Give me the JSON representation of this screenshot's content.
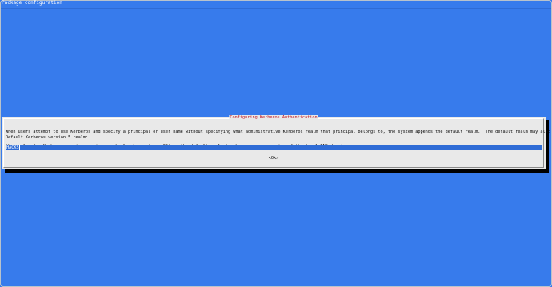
{
  "backtitle": "Package configuration",
  "dialog": {
    "title": "Configuring Kerberos Authentication",
    "message_lines": [
      "When users attempt to use Kerberos and specify a principal or user name without specifying what administrative Kerberos realm that principal belongs to, the system appends the default realm.  The default realm may also be used as",
      "the realm of a Kerberos service running on the local machine.  Often, the default realm is the uppercase version of the local DNS domain."
    ],
    "prompt": "Default Kerberos version 5 realm:",
    "input_value": "HACKS",
    "ok_label": "<Ok>"
  },
  "colors": {
    "background": "#377bec",
    "dialog_background": "#e9e9e9",
    "title_color": "#c0121c",
    "input_highlight": "#2f6cd6"
  }
}
